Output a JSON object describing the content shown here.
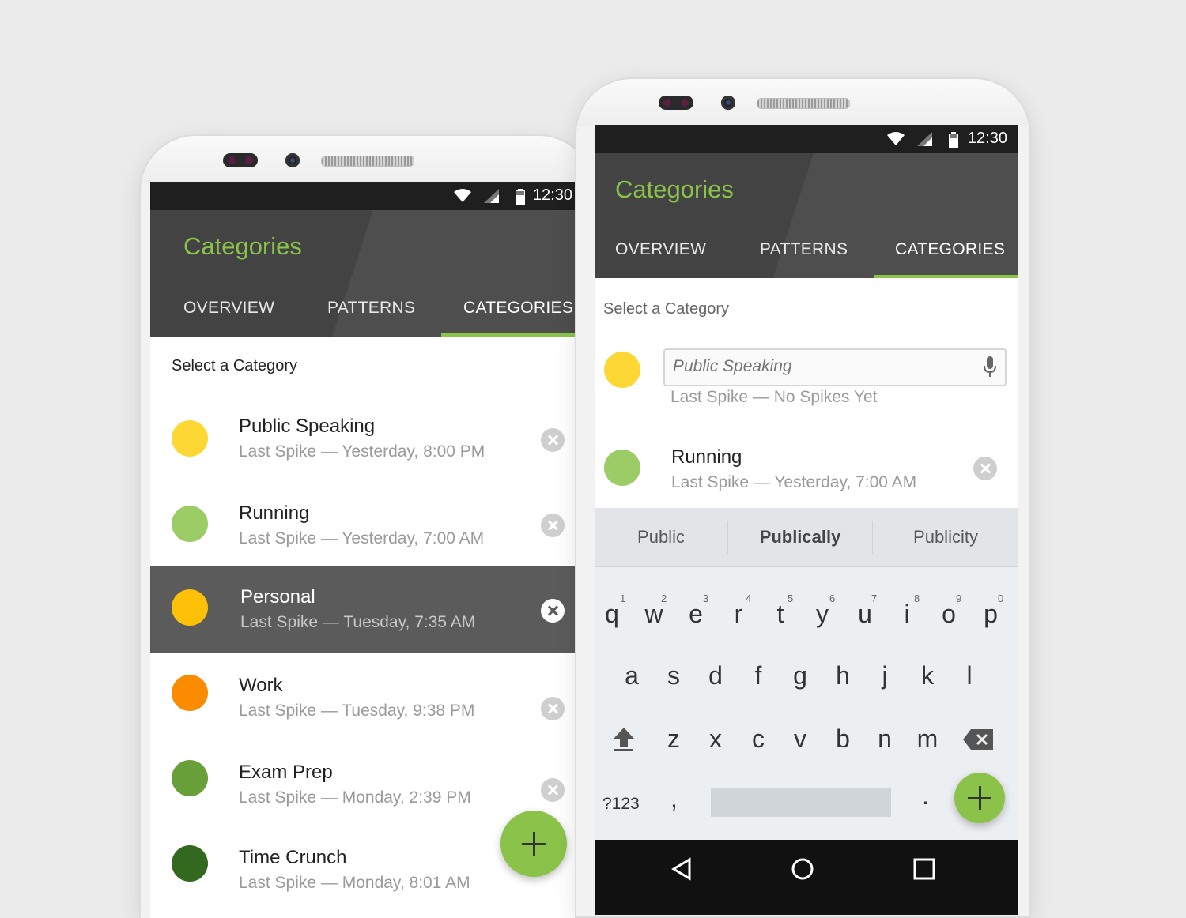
{
  "left_phone": {
    "status_time": "12:30",
    "app_title": "Categories",
    "tabs": [
      "OVERVIEW",
      "PATTERNS",
      "CATEGORIES"
    ],
    "section_title": "Select a Category",
    "items": [
      {
        "name": "Public Speaking",
        "sub": "Last Spike — Yesterday, 8:00 PM",
        "color": "#fdd835"
      },
      {
        "name": "Running",
        "sub": "Last Spike — Yesterday, 7:00 AM",
        "color": "#9ccc65"
      },
      {
        "name": "Personal",
        "sub": "Last Spike — Tuesday, 7:35 AM",
        "color": "#ffc107"
      },
      {
        "name": "Work",
        "sub": "Last Spike — Tuesday, 9:38 PM",
        "color": "#fb8c00"
      },
      {
        "name": "Exam Prep",
        "sub": "Last Spike — Monday, 2:39 PM",
        "color": "#689f38"
      },
      {
        "name": "Time Crunch",
        "sub": "Last Spike — Monday, 8:01 AM",
        "color": "#33691e"
      }
    ]
  },
  "right_phone": {
    "status_time": "12:30",
    "app_title": "Categories",
    "tabs": [
      "OVERVIEW",
      "PATTERNS",
      "CATEGORIES"
    ],
    "section_title": "Select a Category",
    "new_item": {
      "placeholder": "Public Speaking",
      "sub": "Last Spike — No Spikes Yet",
      "color": "#fdd835"
    },
    "items": [
      {
        "name": "Running",
        "sub": "Last Spike — Yesterday, 7:00 AM",
        "color": "#9ccc65"
      }
    ],
    "suggestions": [
      "Public",
      "Publically",
      "Publicity"
    ],
    "keyboard": {
      "row1": [
        "q",
        "w",
        "e",
        "r",
        "t",
        "y",
        "u",
        "i",
        "o",
        "p"
      ],
      "row1_nums": [
        "1",
        "2",
        "3",
        "4",
        "5",
        "6",
        "7",
        "8",
        "9",
        "0"
      ],
      "row2": [
        "a",
        "s",
        "d",
        "f",
        "g",
        "h",
        "j",
        "k",
        "l"
      ],
      "row3": [
        "z",
        "x",
        "c",
        "v",
        "b",
        "n",
        "m"
      ],
      "symbols_key": "?123",
      "comma_key": ",",
      "period_key": "."
    }
  }
}
